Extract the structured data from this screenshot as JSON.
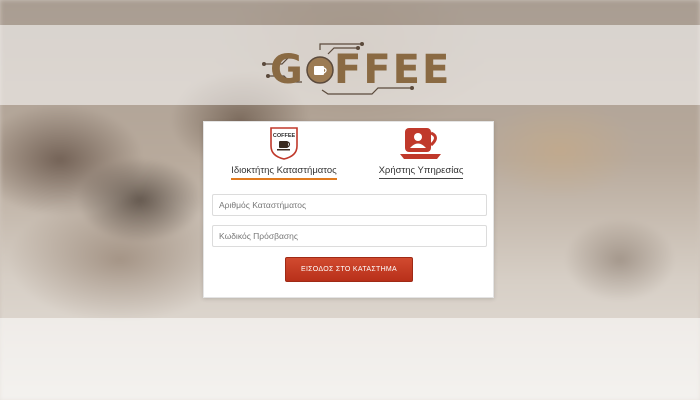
{
  "logo": {
    "text_prefix": "G",
    "text_middle": "O",
    "text_suffix": "FFEE",
    "icon": "coffee-circuit-logo-icon"
  },
  "roles": [
    {
      "label": "Ιδιοκτήτης Καταστήματος",
      "icon": "coffee-cup-shield-icon",
      "icon_text": "COFFEE",
      "selected": true
    },
    {
      "label": "Χρήστης Υπηρεσίας",
      "icon": "user-coffee-cup-icon",
      "selected": false
    }
  ],
  "form": {
    "store_number_placeholder": "Αριθμός Καταστήματος",
    "access_code_placeholder": "Κωδικός Πρόσβασης",
    "submit_label": "ΕΙΣΟΔΟΣ ΣΤΟ ΚΑΤΑΣΤΗΜΑ"
  },
  "colors": {
    "accent_orange": "#e07a1f",
    "button_red": "#c23b22",
    "user_icon_red": "#c0392b",
    "logo_brown": "#8a6a43"
  }
}
